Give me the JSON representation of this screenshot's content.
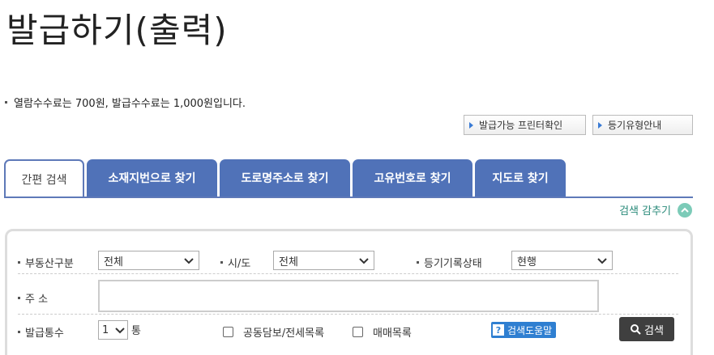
{
  "page": {
    "title": "발급하기(출력)"
  },
  "notice": {
    "fee_text": "열람수수료는 700원, 발급수수료는 1,000원입니다."
  },
  "top_buttons": [
    {
      "label": "발급가능 프린터확인"
    },
    {
      "label": "등기유형안내"
    }
  ],
  "tabs": [
    {
      "label": "간편 검색",
      "active": true
    },
    {
      "label": "소재지번으로 찾기"
    },
    {
      "label": "도로명주소로 찾기"
    },
    {
      "label": "고유번호로 찾기"
    },
    {
      "label": "지도로 찾기"
    }
  ],
  "hide_search": {
    "label": "검색 감추기"
  },
  "form": {
    "property_type": {
      "label": "부동산구분",
      "value": "전체"
    },
    "sido": {
      "label": "시/도",
      "value": "전체"
    },
    "record_status": {
      "label": "등기기록상태",
      "value": "현행"
    },
    "address": {
      "label": "주 소",
      "value": ""
    },
    "copies": {
      "label": "발급통수",
      "value": "1",
      "unit": "통"
    },
    "joint_collateral": {
      "label": "공동담보/전세목록",
      "checked": false
    },
    "sale_list": {
      "label": "매매목록",
      "checked": false
    },
    "help_label": "검색도움말",
    "search_label": "검색"
  },
  "colors": {
    "tab_blue": "#5072b8",
    "accent_teal": "#2a8a7a",
    "help_blue": "#2f7fd1",
    "search_dark": "#3f3f3f"
  }
}
